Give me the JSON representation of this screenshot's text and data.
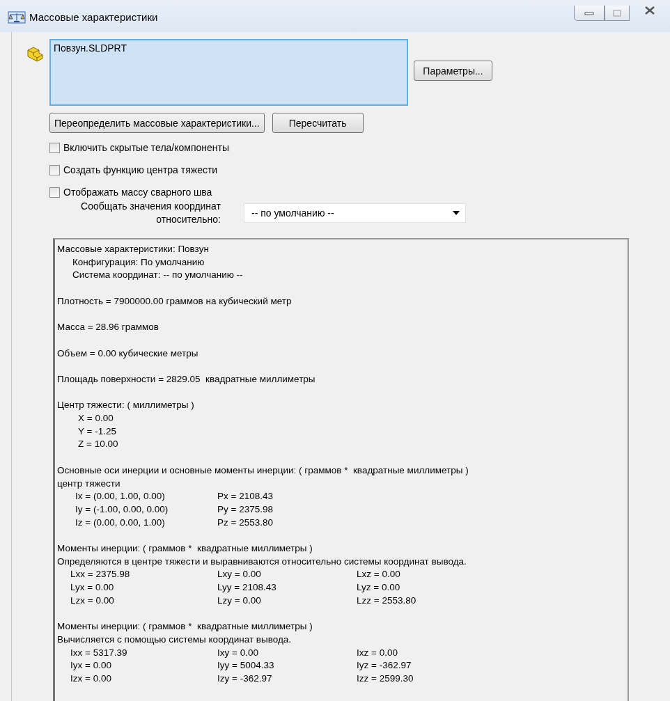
{
  "window": {
    "title": "Массовые характеристики"
  },
  "selection_list": {
    "items": [
      {
        "label": "Повзун.SLDPRT"
      }
    ]
  },
  "buttons": {
    "options": "Параметры...",
    "override": "Переопределить массовые характеристики...",
    "recalculate": "Пересчитать"
  },
  "checkboxes": [
    {
      "label": "Включить скрытые тела/компоненты",
      "checked": false
    },
    {
      "label": "Создать функцию центра тяжести",
      "checked": false
    },
    {
      "label": "Отображать массу сварного шва",
      "checked": false
    }
  ],
  "coordinate_report": {
    "label": "Сообщать значения координат относительно:",
    "value": "-- по умолчанию --"
  },
  "report": {
    "sections": [
      {
        "lines": [
          {
            "kind": "text",
            "cells": [
              "Массовые характеристики: Повзун"
            ]
          },
          {
            "kind": "sub",
            "cells": [
              "Конфигурация: По умолчанию"
            ]
          },
          {
            "kind": "sub",
            "cells": [
              "Система координат: -- по умолчанию --"
            ]
          }
        ]
      },
      {
        "lines": [
          {
            "kind": "text",
            "cells": [
              "Плотность = 7900000.00 граммов на кубический метр"
            ]
          }
        ]
      },
      {
        "lines": [
          {
            "kind": "text",
            "cells": [
              "Масса = 28.96 граммов"
            ]
          }
        ]
      },
      {
        "lines": [
          {
            "kind": "text",
            "cells": [
              "Объем = 0.00 кубические метры"
            ]
          }
        ]
      },
      {
        "lines": [
          {
            "kind": "text",
            "cells": [
              "Площадь поверхности = 2829.05  квадратные миллиметры"
            ]
          }
        ]
      },
      {
        "lines": [
          {
            "kind": "text",
            "cells": [
              "Центр тяжести: ( миллиметры )"
            ]
          },
          {
            "kind": "value",
            "cells": [
              "X = 0.00"
            ]
          },
          {
            "kind": "value",
            "cells": [
              "Y = -1.25"
            ]
          },
          {
            "kind": "value",
            "cells": [
              "Z = 10.00"
            ]
          }
        ]
      },
      {
        "lines": [
          {
            "kind": "text",
            "cells": [
              "Основные оси инерции и основные моменты инерции: ( граммов *  квадратные миллиметры )"
            ]
          },
          {
            "kind": "text",
            "cells": [
              "центр тяжести"
            ]
          },
          {
            "kind": "axes",
            "cells": [
              "Ix = (0.00, 1.00, 0.00)",
              "Px = 2108.43"
            ]
          },
          {
            "kind": "axes",
            "cells": [
              "Iy = (-1.00, 0.00, 0.00)",
              "Py = 2375.98"
            ]
          },
          {
            "kind": "axes",
            "cells": [
              "Iz = (0.00, 0.00, 1.00)",
              "Pz = 2553.80"
            ]
          }
        ]
      },
      {
        "lines": [
          {
            "kind": "text",
            "cells": [
              "Моменты инерции: ( граммов *  квадратные миллиметры )"
            ]
          },
          {
            "kind": "text",
            "cells": [
              "Определяются в центре тяжести и выравниваются относительно системы координат вывода."
            ]
          },
          {
            "kind": "matrix",
            "cells": [
              "Lxx = 2375.98",
              "Lxy = 0.00",
              "Lxz = 0.00"
            ]
          },
          {
            "kind": "matrix",
            "cells": [
              "Lyx = 0.00",
              "Lyy = 2108.43",
              "Lyz = 0.00"
            ]
          },
          {
            "kind": "matrix",
            "cells": [
              "Lzx = 0.00",
              "Lzy = 0.00",
              "Lzz = 2553.80"
            ]
          }
        ]
      },
      {
        "lines": [
          {
            "kind": "text",
            "cells": [
              "Моменты инерции: ( граммов *  квадратные миллиметры )"
            ]
          },
          {
            "kind": "text",
            "cells": [
              "Вычисляется с помощью системы координат вывода."
            ]
          },
          {
            "kind": "matrix",
            "cells": [
              "Ixx = 5317.39",
              "Ixy = 0.00",
              "Ixz = 0.00"
            ]
          },
          {
            "kind": "matrix",
            "cells": [
              "Iyx = 0.00",
              "Iyy = 5004.33",
              "Iyz = -362.97"
            ]
          },
          {
            "kind": "matrix",
            "cells": [
              "Izx = 0.00",
              "Izy = -362.97",
              "Izz = 2599.30"
            ]
          }
        ]
      }
    ]
  }
}
